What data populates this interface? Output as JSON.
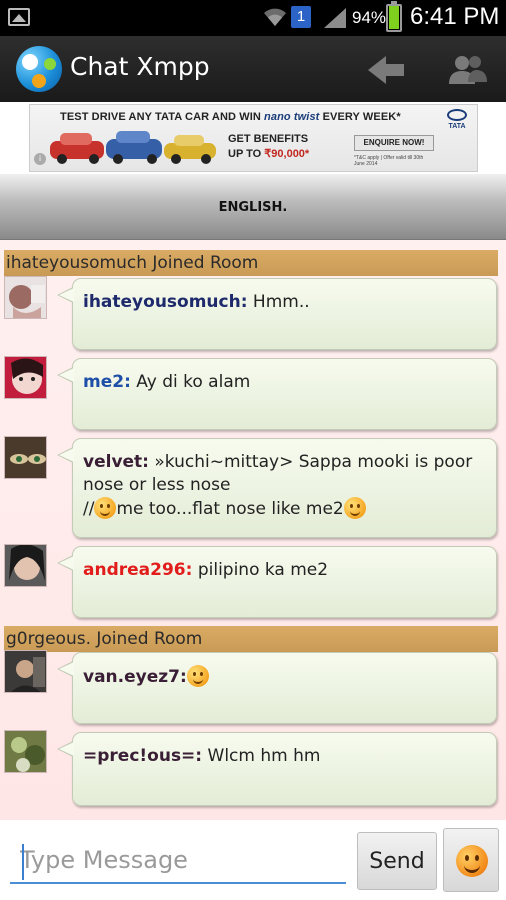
{
  "status_bar": {
    "notification_count": "1",
    "battery_percent": "94%",
    "battery_level": 0.94,
    "time": "6:41 PM",
    "icons": [
      "gallery-icon",
      "wifi-icon",
      "signal-icon",
      "battery-icon"
    ]
  },
  "action_bar": {
    "title": "Chat Xmpp",
    "icons": [
      "app-logo-icon",
      "back-arrow-icon",
      "users-icon"
    ]
  },
  "ad": {
    "headline_prefix": "TEST DRIVE ANY TATA CAR AND WIN ",
    "headline_brand": "nano twist",
    "headline_suffix": " EVERY WEEK*",
    "benefit_line1": "GET BENEFITS",
    "benefit_line2_prefix": "UP TO ",
    "benefit_amount": "₹90,000*",
    "enquire_label": "ENQUIRE NOW!",
    "fine_print": "*T&C apply | Offer valid till 30th June 2014",
    "brand": "TATA"
  },
  "room": {
    "name": "ENGLISH."
  },
  "colors": {
    "join_bar": "#d4a55e",
    "bubble": "#eef4e4",
    "chat_bg": "#ffeaea",
    "input_underline": "#4a8fd6"
  },
  "messages": [
    {
      "type": "join",
      "text": "ihateyousomuch Joined Room"
    },
    {
      "type": "msg",
      "sender": "ihateyousomuch:",
      "sender_color": "#1e2a6b",
      "text": " Hmm.."
    },
    {
      "type": "msg",
      "sender": "me2:",
      "sender_color": "#1d4ea8",
      "text": " Ay di ko alam"
    },
    {
      "type": "msg",
      "sender": "velvet:",
      "sender_color": "#3a1e35",
      "text": " »kuchi~mittay> Sappa mooki is poor nose or less nose",
      "line2_pre": "//",
      "line2_mid": "me too...flat nose like me2"
    },
    {
      "type": "msg",
      "sender": "andrea296:",
      "sender_color": "#e21b1b",
      "text": " pilipino ka me2"
    },
    {
      "type": "join",
      "text": "g0rgeous. Joined Room"
    },
    {
      "type": "msg",
      "sender": "van.eyez7:",
      "sender_color": "#3a1e35",
      "text": ""
    },
    {
      "type": "msg",
      "sender": "=prec!ous=:",
      "sender_color": "#3a1e35",
      "text": " Wlcm hm hm"
    }
  ],
  "composer": {
    "placeholder": "Type Message",
    "send_label": "Send"
  }
}
